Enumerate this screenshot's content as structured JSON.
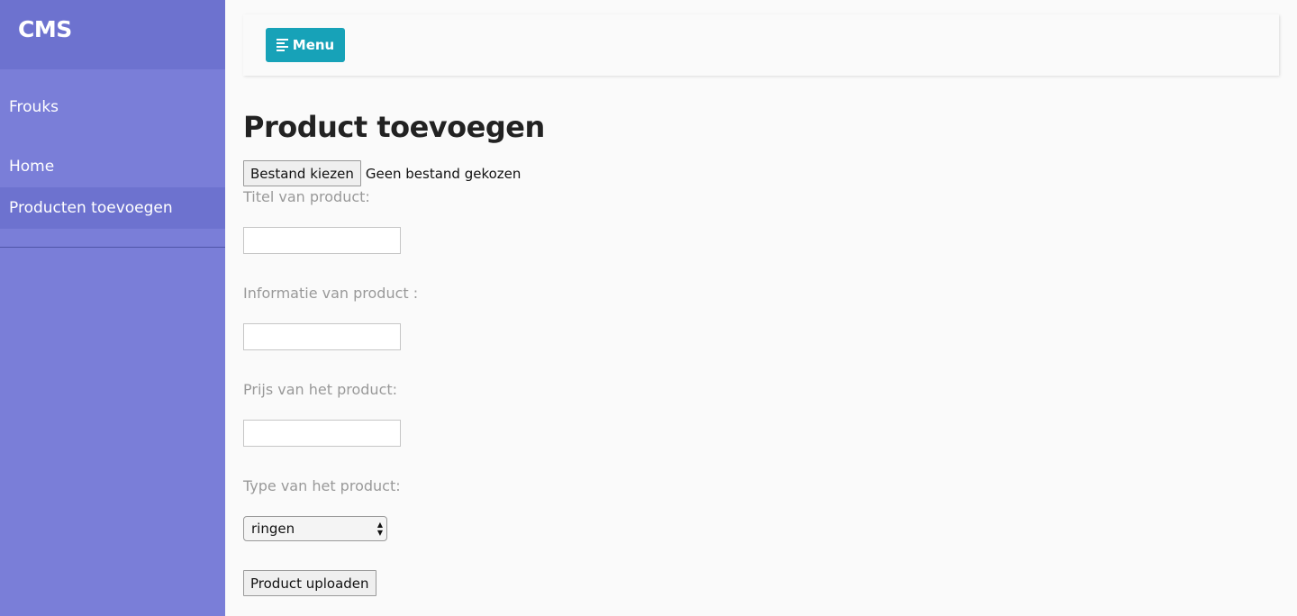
{
  "sidebar": {
    "brand": "CMS",
    "user": "Frouks",
    "items": [
      {
        "label": "Home",
        "active": false
      },
      {
        "label": "Producten toevoegen",
        "active": true
      }
    ]
  },
  "topbar": {
    "menu_label": "Menu",
    "menu_icon": "align-left-icon"
  },
  "page": {
    "title": "Product toevoegen"
  },
  "form": {
    "file_button": "Bestand kiezen",
    "file_status": "Geen bestand gekozen",
    "title_label": "Titel van product:",
    "title_value": "",
    "info_label": "Informatie van product :",
    "info_value": "",
    "price_label": "Prijs van het product:",
    "price_value": "",
    "type_label": "Type van het product:",
    "type_selected": "ringen",
    "submit_label": "Product uploaden"
  },
  "colors": {
    "sidebar": "#7a7ed8",
    "sidebar_header": "#6d72cf",
    "accent": "#17a2b8",
    "background": "#fafafa"
  }
}
